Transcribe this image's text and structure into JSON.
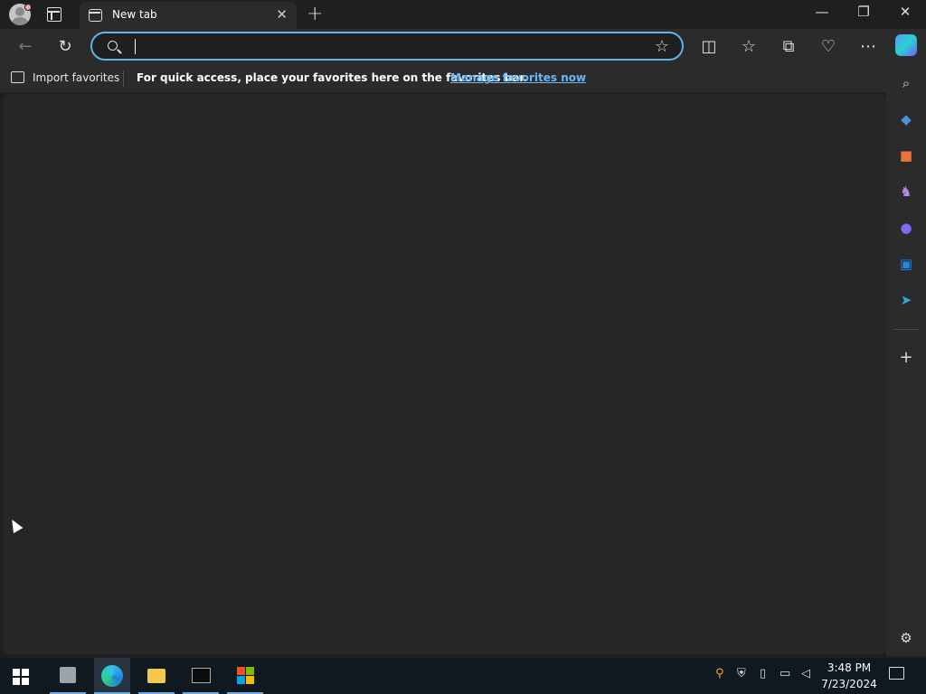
{
  "browser": {
    "tab": {
      "label": "New tab"
    },
    "address_bar": {
      "value": "",
      "placeholder": ""
    }
  },
  "favorites_bar": {
    "import_label": "Import favorites",
    "message": "For quick access, place your favorites here on the favorites bar.",
    "manage_link": "Manage favorites now"
  },
  "sidebar": {
    "items": [
      {
        "icon": "search-icon"
      },
      {
        "icon": "shopping-tag-icon"
      },
      {
        "icon": "tools-icon"
      },
      {
        "icon": "games-icon"
      },
      {
        "icon": "copilot-icon"
      },
      {
        "icon": "outlook-icon"
      },
      {
        "icon": "send-icon"
      }
    ],
    "add_icon": "plus-icon",
    "settings_icon": "gear-icon"
  },
  "taskbar": {
    "apps": [
      {
        "name": "server-manager"
      },
      {
        "name": "microsoft-edge"
      },
      {
        "name": "file-explorer"
      },
      {
        "name": "terminal"
      },
      {
        "name": "windows-flag"
      }
    ],
    "clock": {
      "time": "3:48 PM",
      "date": "7/23/2024"
    }
  },
  "colors": {
    "accent": "#5fb3e6",
    "link": "#6cb8f6",
    "background": "#1f1f1f",
    "content": "#262626",
    "taskbar": "#101820"
  }
}
